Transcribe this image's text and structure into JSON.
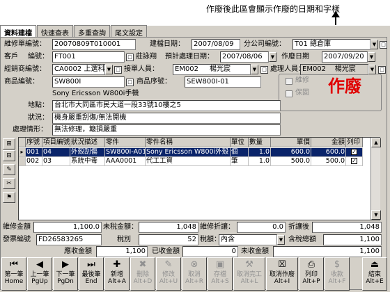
{
  "annotation": "作廢後此區會顯示作廢的日期和字樣",
  "tabs": [
    "資料建檔",
    "快速查表",
    "多重查詢",
    "尾文設定"
  ],
  "form": {
    "repair_no_label": "維修單編號：",
    "repair_no": "20070809T010001",
    "build_date_label": "建檔日期：",
    "build_date": "2007/08/09",
    "branch_label": "分公司編號：",
    "branch": "T01 總倉庫",
    "customer_label": "客戶",
    "customer_no_label": "編號：",
    "customer_no": "FT001",
    "customer_name": "莊詠翔",
    "plan_date_label": "預計處理日期：",
    "plan_date": "2007/08/06",
    "void_date_label": "作廢日期",
    "void_date": "2007/09/20",
    "dealer_label": "經銷商編號：",
    "dealer": "CA0002 上選科",
    "receiver_label": "接單人員：",
    "receiver_no": "EM002",
    "receiver_name": "楊光宸",
    "handler_label": "處理人員：",
    "handler_no": "EM002",
    "handler_name": "楊光宸",
    "product_label": "商品編號：",
    "product": "SW800I",
    "serial_label": "商品序號：",
    "serial": "SEW800I-01",
    "product_name": "Sony Ericsson W800i手機",
    "address_label": "地點：",
    "address": "台北市大同區市民大道一段33號10樓之5",
    "status_label": "狀況：",
    "status": "機身嚴重刮傷/無法開機",
    "process_label": "處理情形：",
    "process": "無法修理，簸損嚴重",
    "repair_check": "維修",
    "warranty_check": "保固",
    "void_text": "作廢"
  },
  "grid": {
    "headers": [
      "序號",
      "項目編號",
      "狀況描述",
      "零件",
      "零件名稱",
      "單位",
      "數量",
      "單價",
      "金額",
      "列印"
    ],
    "rows": [
      {
        "seq": "001",
        "item": "04",
        "desc": "外殼刮傷",
        "part": "SW800I-A01",
        "name": "Sony Ericsson W800i外殼",
        "unit": "個",
        "qty": "1.0",
        "price": "600.0",
        "amount": "600.0"
      },
      {
        "seq": "002",
        "item": "03",
        "desc": "系統中毒",
        "part": "AAA0001",
        "name": "代工工資",
        "unit": "筆",
        "qty": "1.0",
        "price": "500.0",
        "amount": "500.0"
      }
    ]
  },
  "totals": {
    "repair_amt_label": "維修金額",
    "repair_amt": "1,100.0",
    "pretax_label": "未稅金額：",
    "pretax": "1,048",
    "discount_label": "維修折讓：",
    "discount": "0.0",
    "after_disc_label": "折讓後",
    "after_disc": "1,048",
    "invoice_label": "發票編號",
    "invoice": "FD26583265",
    "tax_label": "稅別",
    "tax": "52",
    "tax_type_label": "稅額：",
    "tax_type": "內含",
    "total_label": "含稅總額",
    "total": "1,100",
    "receivable_label": "應收金額",
    "receivable": "1,100",
    "received_label": "已收金額",
    "received": "0",
    "unreceived_label": "未收金額",
    "unreceived": "1,100"
  },
  "toolbar": [
    {
      "l1": "第一筆",
      "l2": "Home",
      "icon": "first-icon",
      "dis": false
    },
    {
      "l1": "上一筆",
      "l2": "PgUp",
      "icon": "prev-icon",
      "dis": false
    },
    {
      "l1": "下一筆",
      "l2": "PgDn",
      "icon": "next-icon",
      "dis": false
    },
    {
      "l1": "最後筆",
      "l2": "End",
      "icon": "last-icon",
      "dis": false
    },
    {
      "l1": "新增",
      "l2": "Alt+A",
      "icon": "add-icon",
      "dis": false
    },
    {
      "l1": "刪除",
      "l2": "Alt+D",
      "icon": "delete-icon",
      "dis": true
    },
    {
      "l1": "修改",
      "l2": "Alt+U",
      "icon": "edit-icon",
      "dis": true
    },
    {
      "l1": "取消",
      "l2": "Alt+R",
      "icon": "cancel-icon",
      "dis": true
    },
    {
      "l1": "存檔",
      "l2": "Alt+S",
      "icon": "save-icon",
      "dis": true
    },
    {
      "l1": "取消完工",
      "l2": "Alt+L",
      "icon": "uncomplete-icon",
      "dis": true
    },
    {
      "l1": "取消作廢",
      "l2": "Alt+I",
      "icon": "unvoid-icon",
      "dis": false
    },
    {
      "l1": "列印",
      "l2": "Alt+P",
      "icon": "print-icon",
      "dis": false
    },
    {
      "l1": "收款",
      "l2": "Alt+F",
      "icon": "receive-icon",
      "dis": true
    },
    {
      "l1": "結束",
      "l2": "Alt+E",
      "icon": "exit-icon",
      "dis": false
    }
  ]
}
